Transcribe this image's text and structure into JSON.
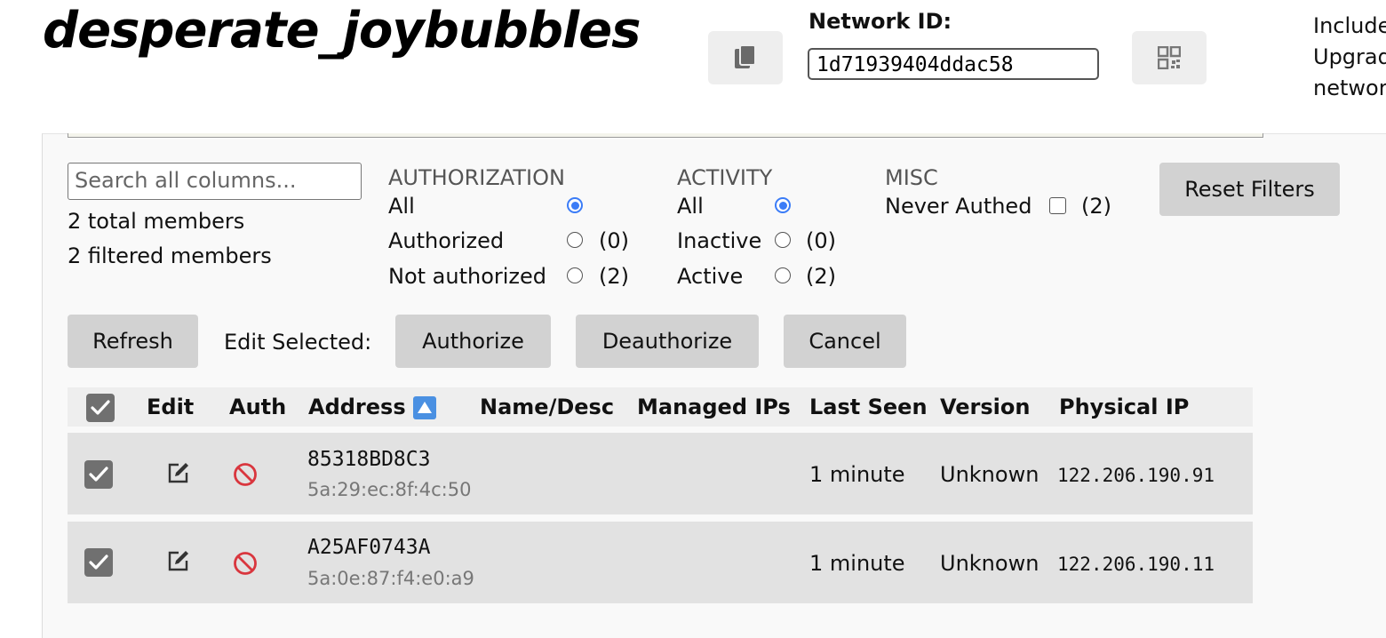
{
  "network": {
    "name": "desperate_joybubbles",
    "id_label": "Network ID:",
    "id_value": "1d71939404ddac58",
    "side_note_lines": [
      "Include",
      "Upgrad",
      "networ"
    ]
  },
  "filters": {
    "search_placeholder": "Search all columns...",
    "total_members": "2 total members",
    "filtered_members": "2 filtered members",
    "authorization": {
      "heading": "AUTHORIZATION",
      "options": [
        {
          "label": "All",
          "count": "",
          "selected": true
        },
        {
          "label": "Authorized",
          "count": "(0)",
          "selected": false
        },
        {
          "label": "Not authorized",
          "count": "(2)",
          "selected": false
        }
      ]
    },
    "activity": {
      "heading": "ACTIVITY",
      "options": [
        {
          "label": "All",
          "count": "",
          "selected": true
        },
        {
          "label": "Inactive",
          "count": "(0)",
          "selected": false
        },
        {
          "label": "Active",
          "count": "(2)",
          "selected": false
        }
      ]
    },
    "misc": {
      "heading": "MISC",
      "never_authed_label": "Never Authed",
      "never_authed_count": "(2)",
      "never_authed_checked": false
    },
    "reset_label": "Reset Filters"
  },
  "actions": {
    "refresh": "Refresh",
    "edit_selected": "Edit Selected:",
    "authorize": "Authorize",
    "deauthorize": "Deauthorize",
    "cancel": "Cancel"
  },
  "table": {
    "headers": {
      "edit": "Edit",
      "auth": "Auth",
      "address": "Address",
      "name": "Name/Desc",
      "managed_ips": "Managed IPs",
      "last_seen": "Last Seen",
      "version": "Version",
      "physical_ip": "Physical IP"
    },
    "sort": {
      "column": "address",
      "direction": "ascending"
    },
    "rows": [
      {
        "selected": true,
        "address": "85318BD8C3",
        "mac": "5a:29:ec:8f:4c:50",
        "name": "",
        "managed_ips": "",
        "last_seen": "1 minute",
        "version": "Unknown",
        "physical_ip": "122.206.190.91",
        "authorized": false
      },
      {
        "selected": true,
        "address": "A25AF0743A",
        "mac": "5a:0e:87:f4:e0:a9",
        "name": "",
        "managed_ips": "",
        "last_seen": "1 minute",
        "version": "Unknown",
        "physical_ip": "122.206.190.11",
        "authorized": false
      }
    ]
  },
  "colors": {
    "radio_selected": "#3b7cf7",
    "deauth_icon": "#d9363e",
    "sort_indicator": "#4a90e2",
    "button_bg": "#d2d2d2",
    "row_bg": "#e2e2e2"
  },
  "icons": {
    "copy": "copy-icon",
    "qr": "qr-code-icon",
    "edit": "edit-icon",
    "deauthorized": "not-authorized-icon",
    "sort": "sort-ascending-icon"
  }
}
